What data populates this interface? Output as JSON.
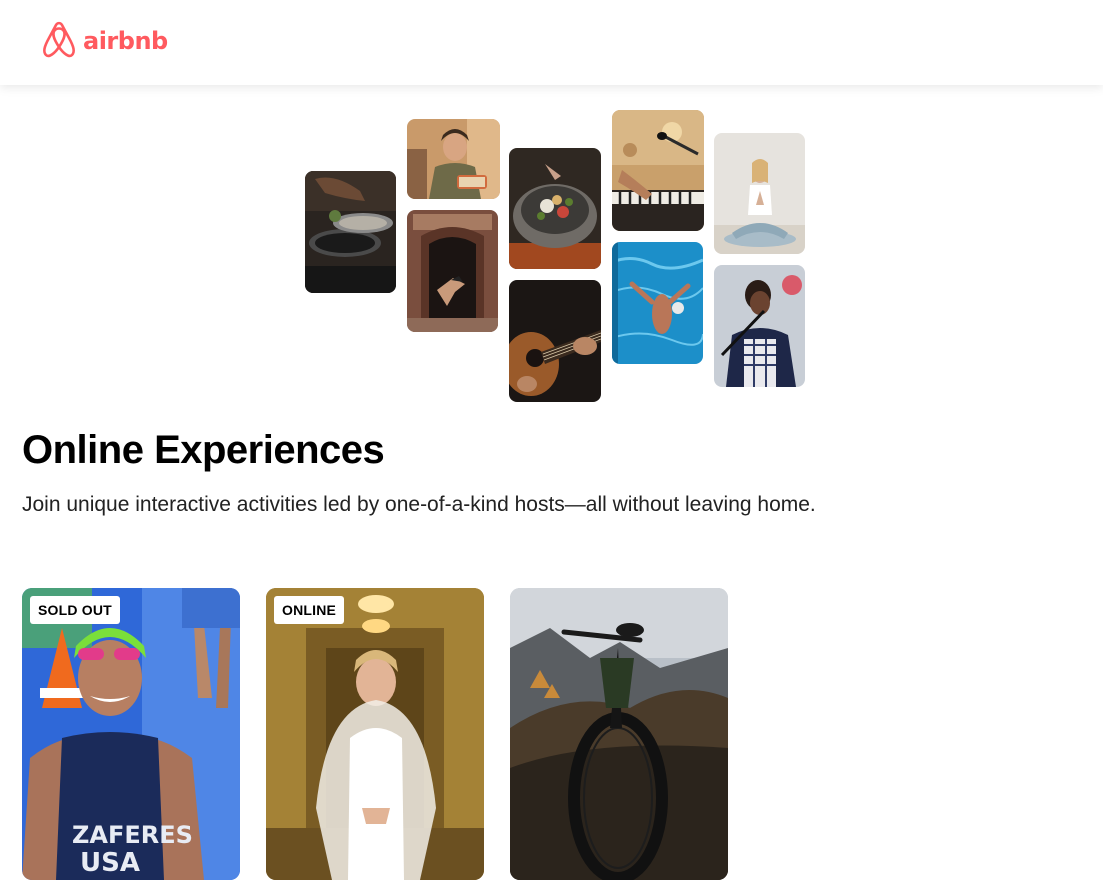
{
  "brand": {
    "logo_text": "airbnb",
    "logo_icon": "airbnb-belo-icon",
    "color": "#FF5A5F"
  },
  "hero": {
    "photos": [
      "cooking-pans",
      "woman-holding-food",
      "dancer-in-doorway",
      "bowl-of-food",
      "acoustic-guitar",
      "piano-microphone",
      "swimmer-in-pool",
      "yoga-meditation",
      "singer-performing"
    ]
  },
  "main": {
    "title": "Online Experiences",
    "subtitle": "Join unique interactive activities led by one-of-a-kind hosts—all without leaving home."
  },
  "cards": [
    {
      "badge": "SOLD OUT",
      "image": "triathlete-smiling"
    },
    {
      "badge": "ONLINE",
      "image": "bride-in-hallway"
    },
    {
      "badge": "",
      "image": "mountain-bike"
    }
  ]
}
